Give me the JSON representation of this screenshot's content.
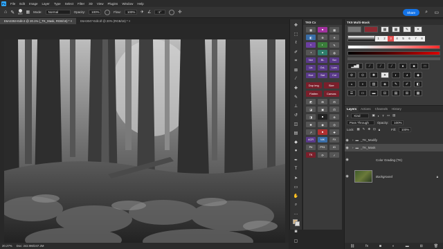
{
  "menubar": {
    "logo": "Ps",
    "items": [
      "File",
      "Edit",
      "Image",
      "Layer",
      "Type",
      "Select",
      "Filter",
      "3D",
      "View",
      "Plugins",
      "Window",
      "Help"
    ]
  },
  "options": {
    "brush_size": "600",
    "mode_label": "Mode:",
    "mode_value": "Normal",
    "opacity_label": "Opacity:",
    "opacity_value": "100%",
    "flow_label": "Flow:",
    "flow_value": "100%",
    "angle_value": "-1°",
    "share_label": "Share"
  },
  "tabs": [
    {
      "label": "E6A2253-Edit-2 @ 20.1% (_TK_Mask, RGB/16) * ×"
    },
    {
      "label": "E6A3047-Edit.tif @ 20% (RGB/16) * ×"
    }
  ],
  "status": {
    "zoom": "20.27%",
    "doc": "Doc: 242.9M/247.2M"
  },
  "tk9cx": {
    "title": "TK9 Cx",
    "buttons": [
      "Nor",
      "BL",
      "Scr",
      "Lin",
      "OvL",
      "Lum",
      "Hue",
      "Sat",
      "Col"
    ],
    "wide_buttons": [
      "Dup img",
      "Size",
      "Flatten",
      "Canvas"
    ],
    "more": [
      "ACR",
      "NIK",
      "FX",
      "Prt",
      "PS1",
      "IG"
    ]
  },
  "tk9mm": {
    "title": "TK9 Multi-Mask",
    "numbers": [
      "1",
      "2",
      "3",
      "4",
      "5",
      "6",
      "7",
      "8"
    ]
  },
  "layers": {
    "tabs": [
      "Layers",
      "Actions",
      "Channels",
      "History"
    ],
    "kind_label": "Kind",
    "blend": "Pass Through",
    "opacity_label": "Opacity:",
    "opacity_value": "100%",
    "lock_label": "Lock:",
    "fill_label": "Fill:",
    "fill_value": "100%",
    "items": [
      {
        "name": "_TK_Modify"
      },
      {
        "name": "_TK_Mask"
      },
      {
        "name": "Color Grading (TK)"
      },
      {
        "name": "Background"
      }
    ]
  },
  "colors": {
    "accent": "#1473e6",
    "panel_bg": "#3a3a3a",
    "tk_red": "#7a1f2b",
    "tk_purple": "#5a3a8a"
  }
}
